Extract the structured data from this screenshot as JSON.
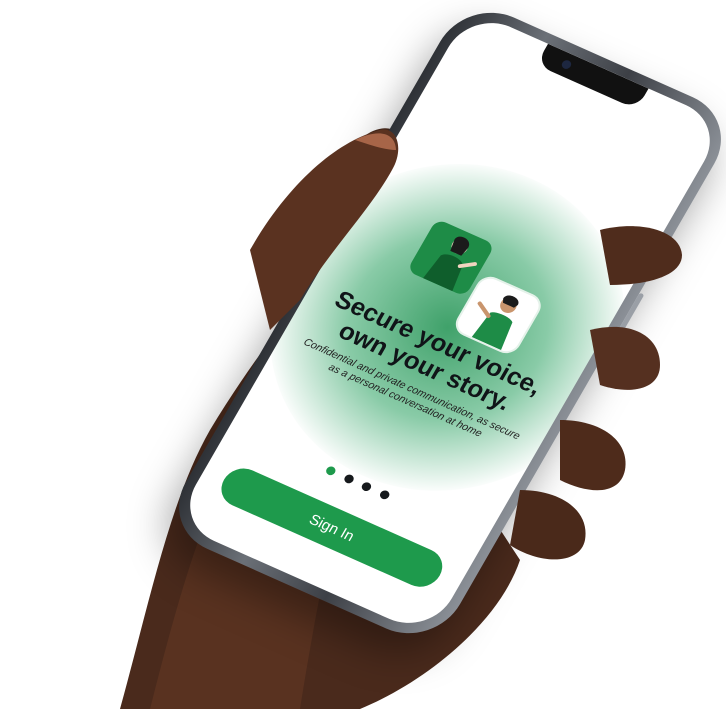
{
  "screen": {
    "headline": "Secure your voice, own your story.",
    "subtitle": "Confidential and private communication, as secure as a personal conversation at home",
    "pagination": {
      "total": 4,
      "active_index": 0
    },
    "signin_label": "Sign In"
  },
  "colors": {
    "brand_green": "#1e9a4c",
    "glow_green": "#2aa060",
    "dot_inactive": "#16191c",
    "phone_frame": "#4a4e55",
    "skin": "#5a3220"
  },
  "icons": [
    "person-pointing-illustration",
    "person-talking-illustration"
  ]
}
